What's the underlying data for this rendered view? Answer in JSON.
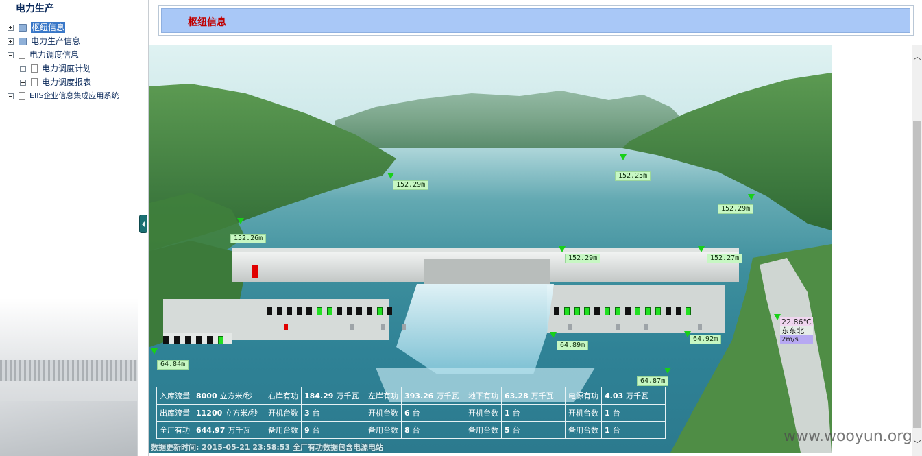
{
  "left_panel": {
    "title": "电力生产",
    "tree": [
      {
        "label": "枢纽信息",
        "expander": "plus",
        "icon": "folder",
        "selected": true
      },
      {
        "label": "电力生产信息",
        "expander": "plus",
        "icon": "folder"
      },
      {
        "label": "电力调度信息",
        "expander": "minus",
        "icon": "doc"
      },
      {
        "label": "电力调度计划",
        "expander": "minus",
        "icon": "doc"
      },
      {
        "label": "电力调度报表",
        "expander": "minus",
        "icon": "doc"
      },
      {
        "label": "EIIS企业信息集成应用系统",
        "expander": "minus",
        "icon": "doc"
      }
    ]
  },
  "header": {
    "title": "枢纽信息",
    "title_color": "#c00000",
    "bar_color": "#a9c8f7"
  },
  "water_levels": [
    "152.29m",
    "152.25m",
    "152.29m",
    "152.26m",
    "152.29m",
    "152.27m",
    "64.89m",
    "64.92m",
    "64.84m",
    "64.87m"
  ],
  "units": {
    "left_bank": [
      "off",
      "off",
      "off",
      "off",
      "off",
      "on",
      "on",
      "off",
      "off",
      "off",
      "off",
      "on",
      "off"
    ],
    "right_bank": [
      "off",
      "on",
      "on",
      "on",
      "off",
      "on",
      "on",
      "off",
      "on",
      "on",
      "on",
      "off",
      "off",
      "on"
    ],
    "left_small": [
      "off",
      "off",
      "off",
      "off",
      "off",
      "on"
    ],
    "marker_colors": {
      "running": "#22e022",
      "stopped": "#111111",
      "alarm": "#e00000"
    }
  },
  "weather": {
    "temp": "22.86℃",
    "wind_dir": "东东北",
    "wind_speed": "2m/s"
  },
  "table": {
    "rows": [
      [
        {
          "k": "入库流量",
          "v": "8000",
          "u": "立方米/秒"
        },
        {
          "k": "右岸有功",
          "v": "184.29",
          "u": "万千瓦"
        },
        {
          "k": "左岸有功",
          "v": "393.26",
          "u": "万千瓦"
        },
        {
          "k": "地下有功",
          "v": "63.28",
          "u": "万千瓦"
        },
        {
          "k": "电源有功",
          "v": "4.03",
          "u": "万千瓦"
        }
      ],
      [
        {
          "k": "出库流量",
          "v": "11200",
          "u": "立方米/秒"
        },
        {
          "k": "开机台数",
          "v": "3",
          "u": "台"
        },
        {
          "k": "开机台数",
          "v": "6",
          "u": "台"
        },
        {
          "k": "开机台数",
          "v": "1",
          "u": "台"
        },
        {
          "k": "开机台数",
          "v": "1",
          "u": "台"
        }
      ],
      [
        {
          "k": "全厂有功",
          "v": "644.97",
          "u": "万千瓦"
        },
        {
          "k": "备用台数",
          "v": "9",
          "u": "台"
        },
        {
          "k": "备用台数",
          "v": "8",
          "u": "台"
        },
        {
          "k": "备用台数",
          "v": "5",
          "u": "台"
        },
        {
          "k": "备用台数",
          "v": "1",
          "u": "台"
        }
      ]
    ]
  },
  "footer_note": "数据更新时间: 2015-05-21 23:58:53 全厂有功数据包含电源电站",
  "watermark": "www.wooyun.org",
  "icons": {
    "collapse": "triangle-left-icon",
    "scroll_up": "chevron-up-icon",
    "scroll_down": "chevron-down-icon"
  }
}
